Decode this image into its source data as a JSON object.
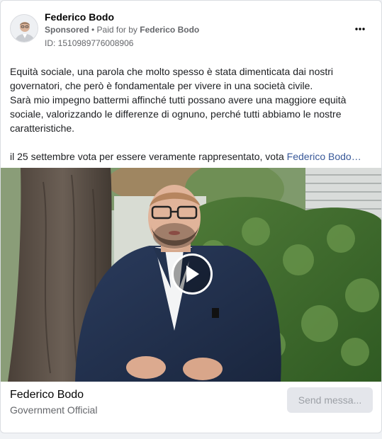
{
  "post": {
    "page_name": "Federico Bodo",
    "sponsored_label": "Sponsored",
    "separator": " • ",
    "paid_for_prefix": "Paid for by ",
    "paid_for_name": "Federico Bodo",
    "ad_id": "ID: 1510989776008906",
    "more_icon": "more-horizontal-icon"
  },
  "body": {
    "paragraph1": "Equità sociale, una parola che molto spesso è stata dimenticata dai nostri governatori, che però è fondamentale per vivere in una società civile.",
    "paragraph2": "Sarà mio impegno battermi affinché tutti possano avere una maggiore equità sociale, valorizzando le differenze di ognuno, perché tutti abbiamo le nostre caratteristiche.",
    "paragraph3_prefix": "il 25 settembre vota per essere veramente rappresentato, vota ",
    "paragraph3_link": "Federico Bodo…"
  },
  "media": {
    "type": "video",
    "play_icon": "play-icon"
  },
  "footer": {
    "name": "Federico Bodo",
    "category": "Government Official",
    "send_label": "Send messa..."
  },
  "colors": {
    "link": "#385898",
    "muted": "#65676b",
    "button_bg": "#e4e6eb"
  }
}
